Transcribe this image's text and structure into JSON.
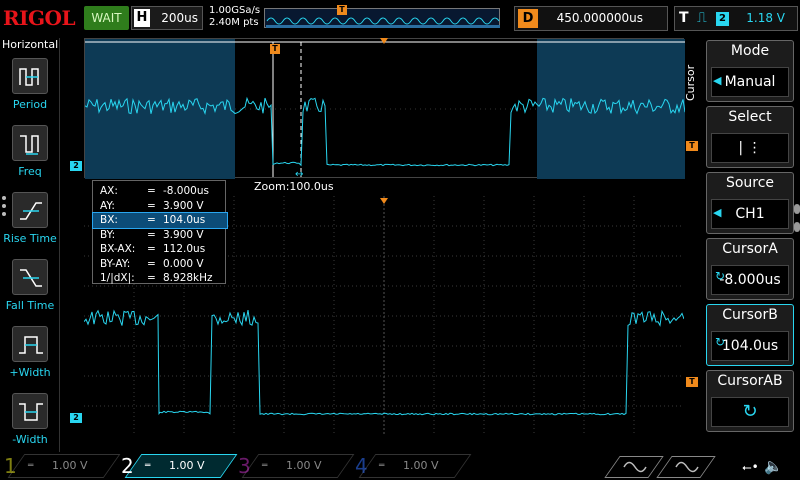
{
  "header": {
    "logo": "RIGOL",
    "run_status": "WAIT",
    "horizontal_label": "H",
    "timebase": "200us",
    "sample_rate": "1.00GSa/s",
    "memory_depth": "2.40M pts",
    "delay_label": "D",
    "delay_value": "450.000000us",
    "trigger_label": "T",
    "trigger_channel": "2",
    "trigger_level": "1.18 V",
    "timeline_marker": "T"
  },
  "left_panel": {
    "title": "Horizontal",
    "items": [
      {
        "label": "Period",
        "icon": "period-icon"
      },
      {
        "label": "Freq",
        "icon": "frequency-icon"
      },
      {
        "label": "Rise Time",
        "icon": "rise-time-icon"
      },
      {
        "label": "Fall Time",
        "icon": "fall-time-icon"
      },
      {
        "label": "+Width",
        "icon": "positive-width-icon"
      },
      {
        "label": "-Width",
        "icon": "negative-width-icon"
      }
    ]
  },
  "zoom": {
    "label": "Zoom:100.0us",
    "channel_marker": "2",
    "trigger_marker": "T"
  },
  "cursor_readout": {
    "rows": [
      {
        "key": "AX:",
        "eq": "=",
        "value": "-8.000us",
        "selected": false
      },
      {
        "key": "AY:",
        "eq": "=",
        "value": "3.900 V",
        "selected": false
      },
      {
        "key": "BX:",
        "eq": "=",
        "value": "104.0us",
        "selected": true
      },
      {
        "key": "BY:",
        "eq": "=",
        "value": "3.900 V",
        "selected": false
      },
      {
        "key": "BX-AX:",
        "eq": "=",
        "value": "112.0us",
        "selected": false
      },
      {
        "key": "BY-AY:",
        "eq": "=",
        "value": "0.000 V",
        "selected": false
      },
      {
        "key": "1/|dX|:",
        "eq": "=",
        "value": "8.928kHz",
        "selected": false
      }
    ]
  },
  "main": {
    "channel_marker": "2",
    "trigger_marker": "T"
  },
  "menu": {
    "title": "Cursor",
    "buttons": [
      {
        "title": "Mode",
        "value": "Manual",
        "icon": "arrow-left-icon"
      },
      {
        "title": "Select",
        "value": "|   ⋮",
        "icon": ""
      },
      {
        "title": "Source",
        "value": "CH1",
        "icon": "arrow-left-icon"
      },
      {
        "title": "CursorA",
        "value": "-8.000us",
        "icon": "knob-icon"
      },
      {
        "title": "CursorB",
        "value": "104.0us",
        "icon": "knob-icon"
      },
      {
        "title": "CursorAB",
        "value": "",
        "icon": "knob-icon"
      }
    ]
  },
  "channels": [
    {
      "number": "1",
      "coupling": "═",
      "scale": "1.00 V",
      "color": "#e8e820",
      "active": false
    },
    {
      "number": "2",
      "coupling": "═",
      "scale": "1.00 V",
      "color": "#29d6f0",
      "active": true
    },
    {
      "number": "3",
      "coupling": "═",
      "scale": "1.00 V",
      "color": "#c030c0",
      "active": false
    },
    {
      "number": "4",
      "coupling": "═",
      "scale": "1.00 V",
      "color": "#3070ff",
      "active": false
    }
  ],
  "colors": {
    "ch2_trace": "#29d6f0",
    "trigger": "#f08a1c",
    "zoom_shade": "#0d3a55"
  }
}
